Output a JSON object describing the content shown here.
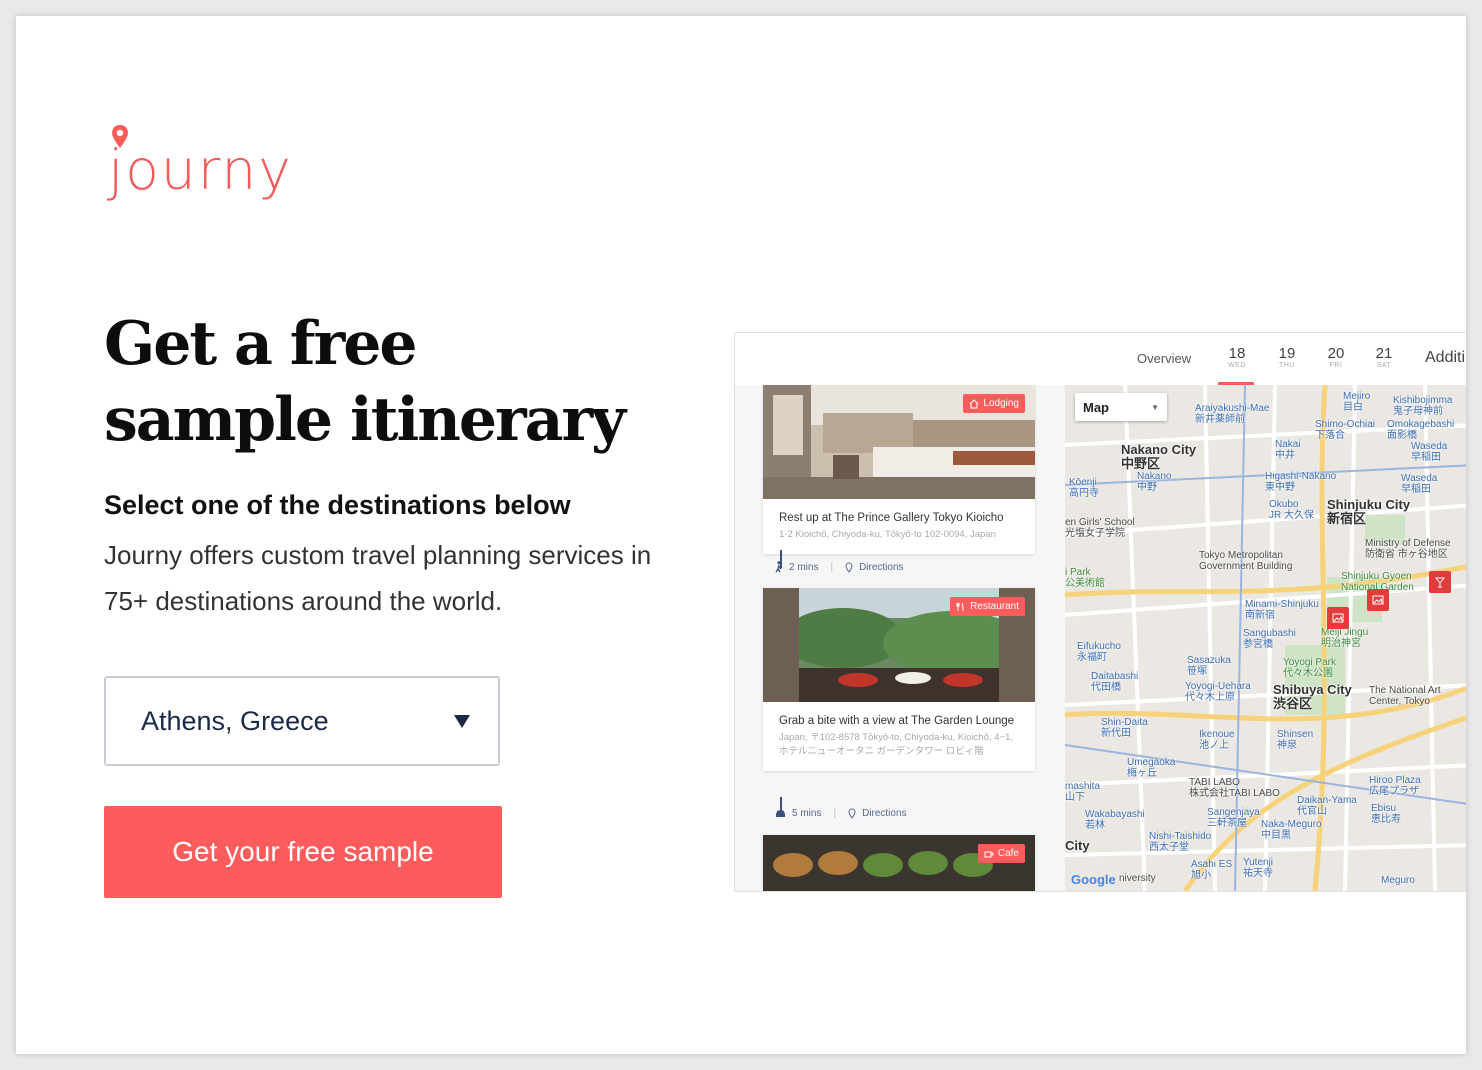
{
  "brand": {
    "name": "journy",
    "color": "#fd5c5c"
  },
  "hero": {
    "headline_line1": "Get a free",
    "headline_line2": "sample itinerary",
    "subheading": "Select one of the destinations below",
    "description": "Journy offers custom travel planning services in 75+ destinations around the world."
  },
  "destination_select": {
    "value": "Athens, Greece"
  },
  "cta": {
    "label": "Get your free sample"
  },
  "preview": {
    "overview_tab": "Overview",
    "days": [
      {
        "num": "18",
        "dow": "WED"
      },
      {
        "num": "19",
        "dow": "THU"
      },
      {
        "num": "20",
        "dow": "FRI"
      },
      {
        "num": "21",
        "dow": "SAT"
      }
    ],
    "additional_tab": "Additi",
    "cards": [
      {
        "badge": "Lodging",
        "title": "Rest up at The Prince Gallery Tokyo Kioicho",
        "address": "1-2 Kioichō, Chiyoda-ku, Tōkyō-to 102-0094, Japan"
      },
      {
        "badge": "Restaurant",
        "title": "Grab a bite with a view at The Garden Lounge",
        "address": "Japan, 〒102-8578 Tōkyō-to, Chiyoda-ku, Kioichō, 4−1, ホテルニューオータニ ガーデンタワー ロビィ階"
      },
      {
        "badge": "Cafe"
      }
    ],
    "transits": [
      {
        "mode_icon": "walk-icon",
        "time": "2 mins",
        "directions": "Directions"
      },
      {
        "mode_icon": "car-icon",
        "time": "5 mins",
        "directions": "Directions"
      }
    ],
    "map": {
      "type_select": "Map",
      "labels": {
        "nakano": "Nakano City",
        "nakano_jp": "中野区",
        "shinjuku": "Shinjuku City",
        "shinjuku_jp": "新宿区",
        "shibuya": "Shibuya City",
        "shibuya_jp": "渋谷区",
        "meiji": "Meiji Jingu",
        "meiji_jp": "明治神宮",
        "yoyogi": "Yoyogi Park",
        "yoyogi_jp": "代々木公園",
        "gyoen": "Shinjuku Gyoen",
        "gyoen2": "National Garden",
        "metro": "Tokyo Metropolitan",
        "metro2": "Government Building",
        "araiyakushi": "Araiyakushi-Mae",
        "araiyakushi_jp": "新井薬師前",
        "mejiro": "Mejiro",
        "mejiro_jp": "目白",
        "waseda": "Waseda",
        "waseda_jp": "早稲田",
        "defense": "Ministry of Defense",
        "defense_jp": "防衛省 市ヶ谷地区",
        "sangubashi": "Sangubashi",
        "sangubashi_jp": "参宮橋",
        "daitabashi": "Daitabashi",
        "daitabashi_jp": "代田橋",
        "eifukucho": "Eifukucho",
        "eifukucho_jp": "永福町",
        "sasazuka": "Sasazuka",
        "sasazuka_jp": "笹塚",
        "ikenoue": "Ikenoue",
        "ikenoue_jp": "池ノ上",
        "shinsen": "Shinsen",
        "shinsen_jp": "神泉",
        "daikanyama": "Daikan-Yama",
        "daikanyama_jp": "代官山",
        "ebisu": "Ebisu",
        "ebisu_jp": "恵比寿",
        "nakameguro": "Naka-Meguro",
        "nakameguro_jp": "中目黒",
        "artcenter": "The National Art",
        "artcenter2": "Center, Tokyo",
        "hiroo": "Hiroo Plaza",
        "hiroo_jp": "広尾プラザ",
        "minami": "Minami-Shinjuku",
        "minami_jp": "南新宿",
        "okubo": "Okubo",
        "okubo_jp": "JR 大久保",
        "nakano_st": "Nakano",
        "nakano_st_jp": "中野",
        "yoyogi_uehara": "Yoyogi-Uehara",
        "yoyogi_uehara_jp": "代々木上原",
        "shindaita": "Shin-Daita",
        "shindaita_jp": "新代田",
        "umegaoka": "Umegaoka",
        "umegaoka_jp": "梅ヶ丘",
        "tabi": "TABI LABO",
        "tabi_jp": "株式会社TABI LABO",
        "sangenjaya": "Sangenjaya",
        "sangenjaya_jp": "三軒茶屋",
        "nishitaishido": "Nishi-Taishido",
        "nishitaishido_jp": "西太子堂",
        "wakabayashi": "Wakabayashi",
        "wakabayashi_jp": "若林",
        "asahi": "Asahi ES",
        "asahi_jp": "旭小",
        "yutenji": "Yutenji",
        "yutenji_jp": "祐天寺",
        "meguro": "Meguro",
        "koenji": "Kōenji",
        "koenji_jp": "高円寺",
        "girls": "en Girls' School",
        "girls_jp": "光塩女子学院",
        "higashi": "Higashi-Nakano",
        "higashi_jp": "東中野",
        "nakai": "Nakai",
        "nakai_jp": "中井",
        "shimo": "Shimo-Ochiai",
        "shimo_jp": "下落合",
        "omokage": "Omokagebashi",
        "omokage_jp": "面影橋",
        "kishibo": "Kishibojimma",
        "kishibo_jp": "鬼子母神前",
        "ipark": "i Park",
        "ipark_jp": "公美術館",
        "mashita": "mashita",
        "mashita_jp": "山下",
        "city": "City",
        "university": "niversity",
        "google": "Google"
      }
    }
  }
}
